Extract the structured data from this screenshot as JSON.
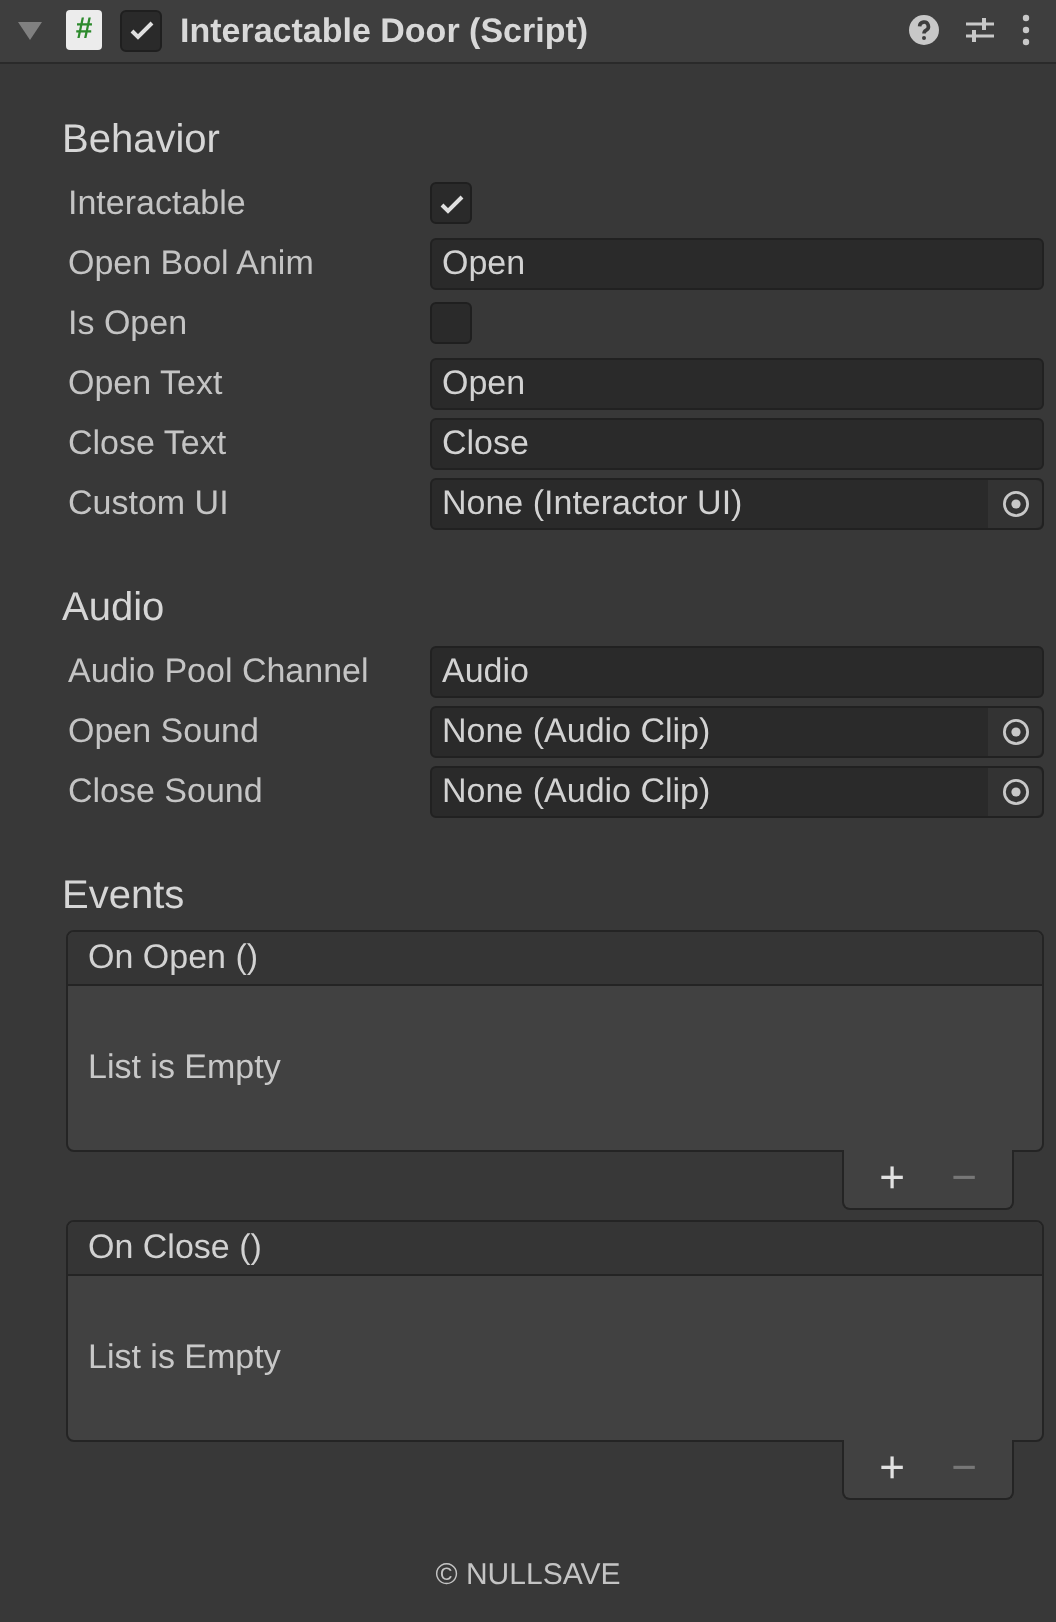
{
  "header": {
    "expanded": true,
    "enabled": true,
    "title": "Interactable Door (Script)",
    "script_glyph": "#"
  },
  "sections": [
    {
      "title": "Behavior",
      "fields": [
        {
          "label": "Interactable",
          "kind": "checkbox",
          "checked": true
        },
        {
          "label": "Open Bool Anim",
          "kind": "text",
          "value": "Open"
        },
        {
          "label": "Is Open",
          "kind": "checkbox",
          "checked": false
        },
        {
          "label": "Open Text",
          "kind": "text",
          "value": "Open"
        },
        {
          "label": "Close Text",
          "kind": "text",
          "value": "Close"
        },
        {
          "label": "Custom UI",
          "kind": "object",
          "value": "None (Interactor UI)"
        }
      ]
    },
    {
      "title": "Audio",
      "fields": [
        {
          "label": "Audio Pool Channel",
          "kind": "text",
          "value": "Audio"
        },
        {
          "label": "Open Sound",
          "kind": "object",
          "value": "None (Audio Clip)"
        },
        {
          "label": "Close Sound",
          "kind": "object",
          "value": "None (Audio Clip)"
        }
      ]
    },
    {
      "title": "Events",
      "events": [
        {
          "name": "On Open ()",
          "empty_text": "List is Empty",
          "buttons": [
            {
              "label": "+",
              "disabled": false
            },
            {
              "label": "−",
              "disabled": true
            }
          ]
        },
        {
          "name": "On Close ()",
          "empty_text": "List is Empty",
          "buttons": [
            {
              "label": "+",
              "disabled": false
            },
            {
              "label": "−",
              "disabled": true
            }
          ]
        }
      ]
    }
  ],
  "footer": "© NULLSAVE"
}
